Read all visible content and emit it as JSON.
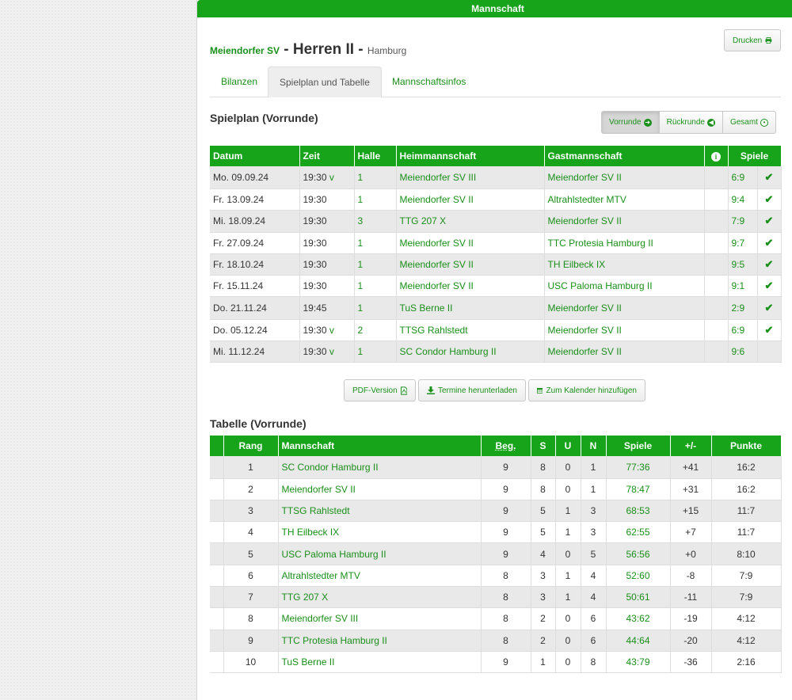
{
  "header": {
    "title": "Mannschaft",
    "print_label": "Drucken"
  },
  "team": {
    "club": "Meiendorfer SV",
    "sep1": " - ",
    "name": "Herren II",
    "sep2": " - ",
    "city": "Hamburg"
  },
  "tabs": [
    {
      "label": "Bilanzen"
    },
    {
      "label": "Spielplan und Tabelle"
    },
    {
      "label": "Mannschaftsinfos"
    }
  ],
  "schedule": {
    "title": "Spielplan (Vorrunde)",
    "buttons": [
      "Vorrunde",
      "Rückrunde",
      "Gesamt"
    ],
    "columns": [
      "Datum",
      "Zeit",
      "Halle",
      "Heimmannschaft",
      "Gastmannschaft",
      "Spiele"
    ],
    "rows": [
      {
        "date": "Mo. 09.09.24",
        "time": "19:30",
        "flag": "v",
        "hall": "1",
        "home": "Meiendorfer SV III",
        "away": "Meiendorfer SV II",
        "result": "6:9",
        "done": true
      },
      {
        "date": "Fr. 13.09.24",
        "time": "19:30",
        "flag": "",
        "hall": "1",
        "home": "Meiendorfer SV II",
        "away": "Altrahlstedter MTV",
        "result": "9:4",
        "done": true
      },
      {
        "date": "Mi. 18.09.24",
        "time": "19:30",
        "flag": "",
        "hall": "3",
        "home": "TTG 207 X",
        "away": "Meiendorfer SV II",
        "result": "7:9",
        "done": true
      },
      {
        "date": "Fr. 27.09.24",
        "time": "19:30",
        "flag": "",
        "hall": "1",
        "home": "Meiendorfer SV II",
        "away": "TTC Protesia Hamburg II",
        "result": "9:7",
        "done": true
      },
      {
        "date": "Fr. 18.10.24",
        "time": "19:30",
        "flag": "",
        "hall": "1",
        "home": "Meiendorfer SV II",
        "away": "TH Eilbeck IX",
        "result": "9:5",
        "done": true
      },
      {
        "date": "Fr. 15.11.24",
        "time": "19:30",
        "flag": "",
        "hall": "1",
        "home": "Meiendorfer SV II",
        "away": "USC Paloma Hamburg II",
        "result": "9:1",
        "done": true
      },
      {
        "date": "Do. 21.11.24",
        "time": "19:45",
        "flag": "",
        "hall": "1",
        "home": "TuS Berne II",
        "away": "Meiendorfer SV II",
        "result": "2:9",
        "done": true
      },
      {
        "date": "Do. 05.12.24",
        "time": "19:30",
        "flag": "v",
        "hall": "2",
        "home": "TTSG Rahlstedt",
        "away": "Meiendorfer SV II",
        "result": "6:9",
        "done": true
      },
      {
        "date": "Mi. 11.12.24",
        "time": "19:30",
        "flag": "v",
        "hall": "1",
        "home": "SC Condor Hamburg II",
        "away": "Meiendorfer SV II",
        "result": "9:6",
        "done": false
      }
    ]
  },
  "downloads": {
    "pdf": "PDF-Version",
    "termine": "Termine herunterladen",
    "kalender": "Zum Kalender hinzufügen"
  },
  "standings": {
    "title": "Tabelle (Vorrunde)",
    "columns": [
      "Rang",
      "Mannschaft",
      "Beg.",
      "S",
      "U",
      "N",
      "Spiele",
      "+/-",
      "Punkte"
    ],
    "rows": [
      {
        "rank": "1",
        "team": "SC Condor Hamburg II",
        "beg": "9",
        "s": "8",
        "u": "0",
        "n": "1",
        "games": "77:36",
        "diff": "+41",
        "points": "16:2"
      },
      {
        "rank": "2",
        "team": "Meiendorfer SV II",
        "beg": "9",
        "s": "8",
        "u": "0",
        "n": "1",
        "games": "78:47",
        "diff": "+31",
        "points": "16:2"
      },
      {
        "rank": "3",
        "team": "TTSG Rahlstedt",
        "beg": "9",
        "s": "5",
        "u": "1",
        "n": "3",
        "games": "68:53",
        "diff": "+15",
        "points": "11:7"
      },
      {
        "rank": "4",
        "team": "TH Eilbeck IX",
        "beg": "9",
        "s": "5",
        "u": "1",
        "n": "3",
        "games": "62:55",
        "diff": "+7",
        "points": "11:7"
      },
      {
        "rank": "5",
        "team": "USC Paloma Hamburg II",
        "beg": "9",
        "s": "4",
        "u": "0",
        "n": "5",
        "games": "56:56",
        "diff": "+0",
        "points": "8:10"
      },
      {
        "rank": "6",
        "team": "Altrahlstedter MTV",
        "beg": "8",
        "s": "3",
        "u": "1",
        "n": "4",
        "games": "52:60",
        "diff": "-8",
        "points": "7:9"
      },
      {
        "rank": "7",
        "team": "TTG 207 X",
        "beg": "8",
        "s": "3",
        "u": "1",
        "n": "4",
        "games": "50:61",
        "diff": "-11",
        "points": "7:9"
      },
      {
        "rank": "8",
        "team": "Meiendorfer SV III",
        "beg": "8",
        "s": "2",
        "u": "0",
        "n": "6",
        "games": "43:62",
        "diff": "-19",
        "points": "4:12"
      },
      {
        "rank": "9",
        "team": "TTC Protesia Hamburg II",
        "beg": "8",
        "s": "2",
        "u": "0",
        "n": "6",
        "games": "44:64",
        "diff": "-20",
        "points": "4:12"
      },
      {
        "rank": "10",
        "team": "TuS Berne II",
        "beg": "9",
        "s": "1",
        "u": "0",
        "n": "8",
        "games": "43:79",
        "diff": "-36",
        "points": "2:16"
      }
    ]
  },
  "icons": {
    "print": "printer-icon",
    "info": "info-icon",
    "check": "check-icon",
    "pdf": "file-pdf-icon",
    "download": "download-icon",
    "calendar": "calendar-icon"
  },
  "colors": {
    "brand": "#17a31a",
    "link": "#1a8f1a"
  }
}
